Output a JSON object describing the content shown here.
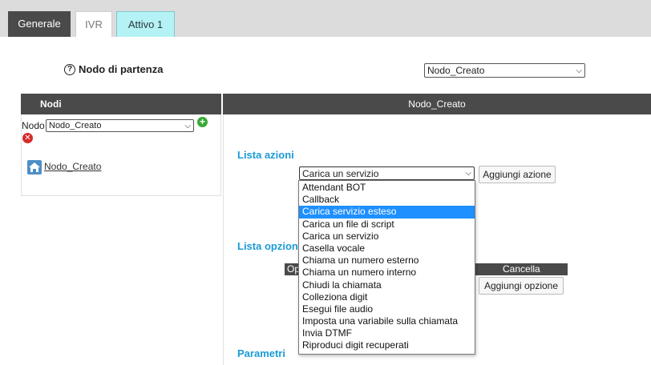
{
  "tabs": [
    {
      "label": "Generale"
    },
    {
      "label": "IVR"
    },
    {
      "label": "Attivo 1"
    }
  ],
  "start_node": {
    "label": "Nodo di partenza",
    "selected": "Nodo_Creato"
  },
  "left_panel": {
    "header": "Nodi",
    "nodo_label": "Nodo",
    "nodo_selected": "Nodo_Creato",
    "node_link": "Nodo_Creato"
  },
  "right_panel": {
    "header": "Nodo_Creato",
    "lista_azioni": "Lista azioni",
    "action_selected": "Carica un servizio",
    "add_action": "Aggiungi azione",
    "lista_opzioni": "Lista opzion",
    "options_col_op": "Op",
    "options_col_cancel": "Cancella",
    "add_option": "Aggiungi opzione",
    "parametri": "Parametri"
  },
  "dropdown": {
    "highlighted": "Carica servizio esteso",
    "options": [
      "Attendant BOT",
      "Callback",
      "Carica servizio esteso",
      "Carica un file di script",
      "Carica un servizio",
      "Casella vocale",
      "Chiama un numero esterno",
      "Chiama un numero interno",
      "Chiudi la chiamata",
      "Colleziona digit",
      "Esegui file audio",
      "Imposta una variabile sulla chiamata",
      "Invia DTMF",
      "Riproduci digit recuperati"
    ]
  },
  "colors": {
    "header_dark": "#4a4a4a",
    "accent_blue": "#1a9bd7",
    "tab_active": "#b5f2f5",
    "highlight": "#1e90ff"
  }
}
